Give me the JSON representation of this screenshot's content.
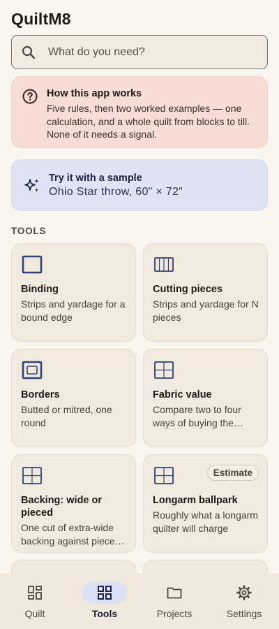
{
  "app": {
    "title": "QuiltM8"
  },
  "search": {
    "placeholder": "What do you need?",
    "icon": "search-icon"
  },
  "info": {
    "title": "How this app works",
    "body": "Five rules, then two worked examples — one calculation, and a whole quilt from blocks to till. None of it needs a signal.",
    "icon": "help-circle-icon"
  },
  "sample": {
    "title": "Try it with a sample",
    "subtitle": "Ohio Star throw, 60\" × 72\"",
    "icon": "sparkles-icon"
  },
  "tools_section": {
    "label": "TOOLS"
  },
  "tools": [
    {
      "name": "Binding",
      "desc": "Strips and yardage for a bound edge",
      "icon": "binding-icon"
    },
    {
      "name": "Cutting pieces",
      "desc": "Strips and yardage for N pieces",
      "icon": "cutting-strips-icon"
    },
    {
      "name": "Borders",
      "desc": "Butted or mitred, one round",
      "icon": "borders-icon"
    },
    {
      "name": "Fabric value",
      "desc": "Compare two to four ways of buying the same fabric",
      "icon": "grid-icon"
    },
    {
      "name": "Backing: wide or pieced",
      "desc": "One cut of extra-wide backing against pieced backing",
      "icon": "grid-icon"
    },
    {
      "name": "Longarm ballpark",
      "desc": "Roughly what a longarm quilter will charge",
      "icon": "grid-icon",
      "badge": "Estimate"
    }
  ],
  "nav": {
    "items": [
      {
        "label": "Quilt",
        "icon": "dashboard-icon"
      },
      {
        "label": "Tools",
        "icon": "apps-grid-icon",
        "active": true
      },
      {
        "label": "Projects",
        "icon": "folder-icon"
      },
      {
        "label": "Settings",
        "icon": "gear-icon"
      }
    ]
  },
  "colors": {
    "background": "#f9f5ef",
    "info_card": "#f8ddd5",
    "sample_card": "#dfe3f4",
    "tool_card": "#f2e9df",
    "icon_blue": "#2d4477",
    "nav_active_pill": "#dbe2f6"
  }
}
